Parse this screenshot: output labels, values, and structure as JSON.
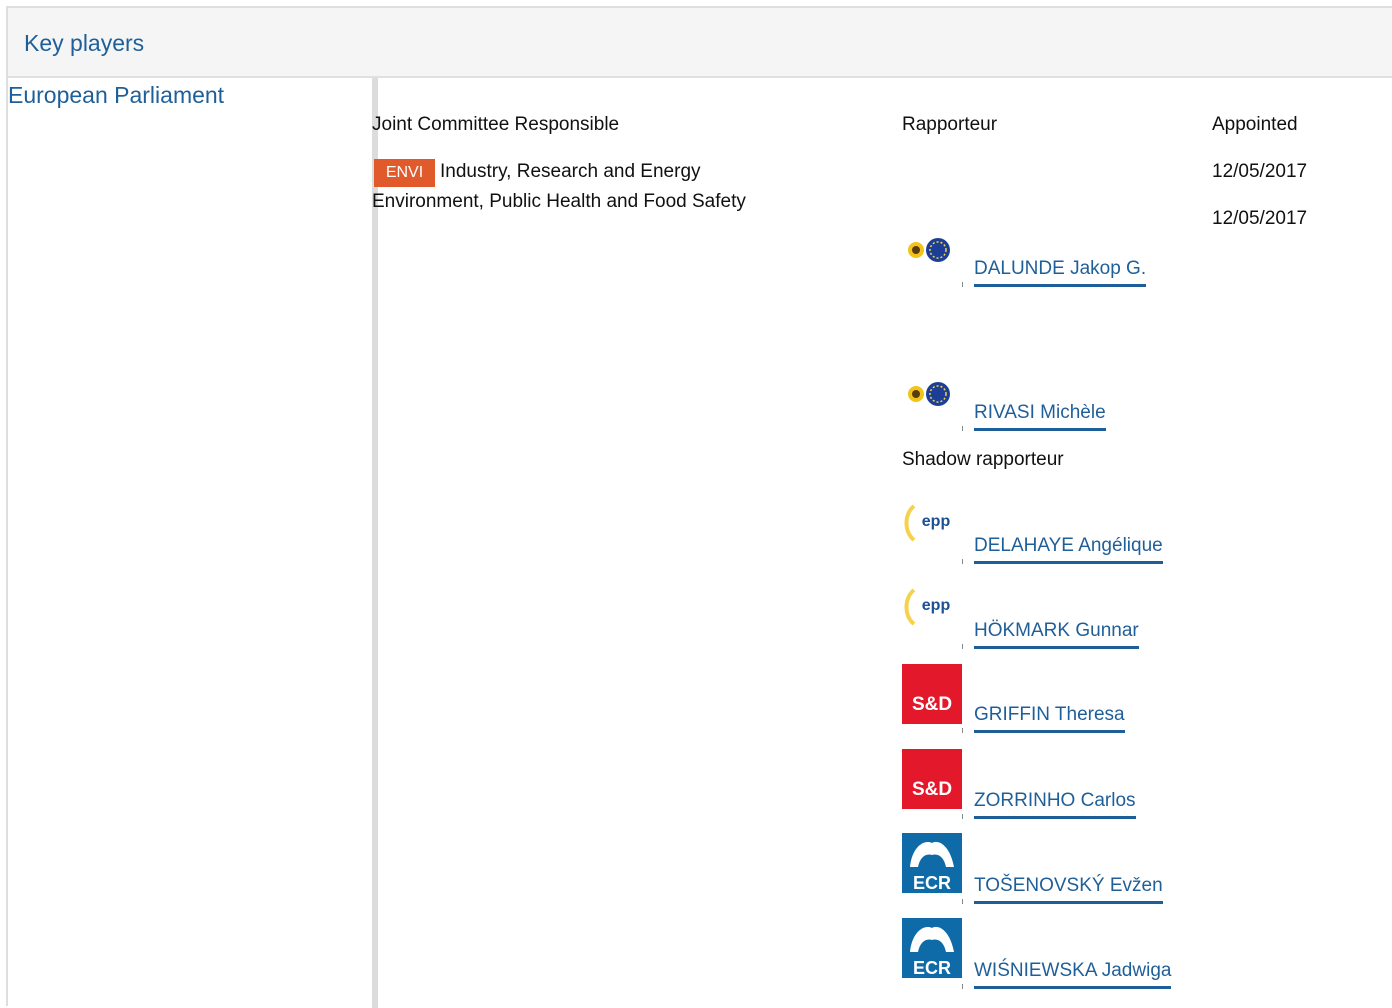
{
  "section_title": "Key players",
  "institution": "European Parliament",
  "headers": {
    "committee": "Joint Committee Responsible",
    "rapporteur": "Rapporteur",
    "appointed": "Appointed",
    "shadow": "Shadow rapporteur"
  },
  "committee": {
    "badge": "ENVI",
    "line1": "Industry, Research and Energy",
    "line2": "Environment, Public Health and Food Safety"
  },
  "appointed_dates": [
    "12/05/2017",
    "12/05/2017"
  ],
  "rapporteurs": [
    {
      "name": "DALUNDE Jakop G.",
      "group_logo": "greens-efa-logo"
    },
    {
      "name": "RIVASI Michèle",
      "group_logo": "greens-efa-logo"
    }
  ],
  "shadow_rapporteurs": [
    {
      "name": "DELAHAYE Angélique",
      "group_logo": "epp-logo",
      "logo_text": "epp"
    },
    {
      "name": "HÖKMARK Gunnar",
      "group_logo": "epp-logo",
      "logo_text": "epp"
    },
    {
      "name": "GRIFFIN Theresa",
      "group_logo": "sd-logo",
      "logo_text": "S&D"
    },
    {
      "name": "ZORRINHO Carlos",
      "group_logo": "sd-logo",
      "logo_text": "S&D"
    },
    {
      "name": "TOŠENOVSKÝ Evžen",
      "group_logo": "ecr-logo",
      "logo_text": "ECR"
    },
    {
      "name": "WIŚNIEWSKA Jadwiga",
      "group_logo": "ecr-logo",
      "logo_text": "ECR"
    }
  ],
  "colors": {
    "link": "#1f5f99",
    "badge": "#e05a2b",
    "sd_red": "#e3192b",
    "ecr_blue": "#0e6ba8",
    "epp_blue": "#1c4f95",
    "epp_yellow": "#f5d24a"
  }
}
